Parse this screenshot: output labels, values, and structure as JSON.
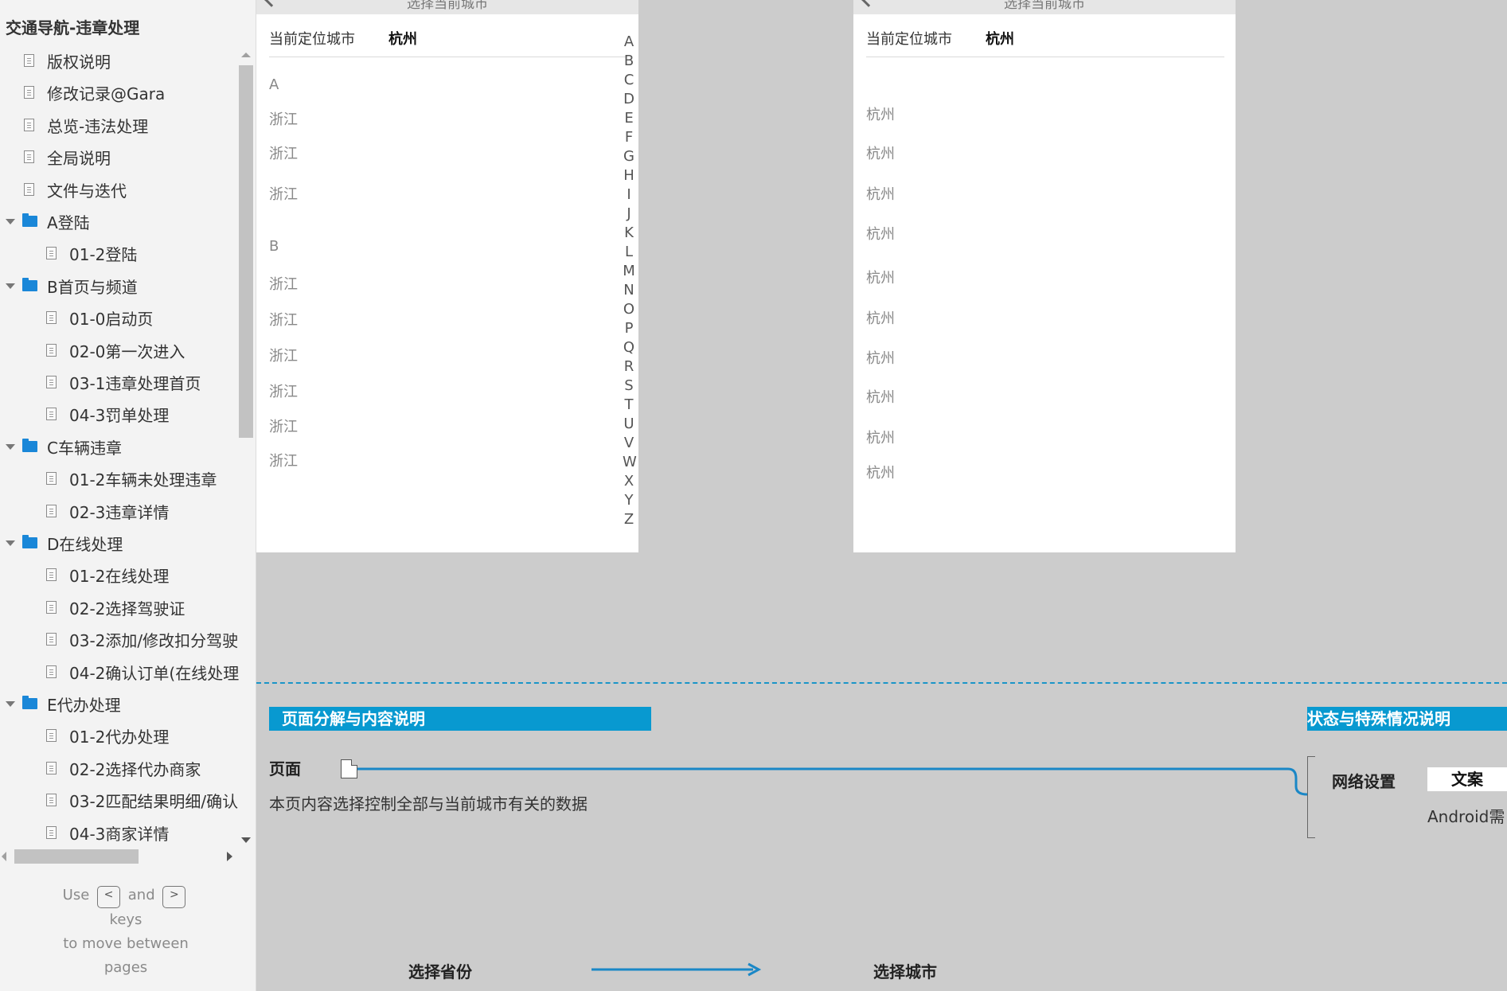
{
  "sidebar": {
    "title": "交通导航-违章处理",
    "items": [
      {
        "label": "版权说明",
        "type": "page",
        "level": 0
      },
      {
        "label": "修改记录@Gara",
        "type": "page",
        "level": 0
      },
      {
        "label": "总览-违法处理",
        "type": "page",
        "level": 0
      },
      {
        "label": "全局说明",
        "type": "page",
        "level": 0
      },
      {
        "label": "文件与迭代",
        "type": "page",
        "level": 0
      },
      {
        "label": "A登陆",
        "type": "folder",
        "level": 0
      },
      {
        "label": "01-2登陆",
        "type": "page",
        "level": 1
      },
      {
        "label": "B首页与频道",
        "type": "folder",
        "level": 0
      },
      {
        "label": "01-0启动页",
        "type": "page",
        "level": 1
      },
      {
        "label": "02-0第一次进入",
        "type": "page",
        "level": 1
      },
      {
        "label": "03-1违章处理首页",
        "type": "page",
        "level": 1
      },
      {
        "label": "04-3罚单处理",
        "type": "page",
        "level": 1
      },
      {
        "label": "C车辆违章",
        "type": "folder",
        "level": 0
      },
      {
        "label": "01-2车辆未处理违章",
        "type": "page",
        "level": 1
      },
      {
        "label": "02-3违章详情",
        "type": "page",
        "level": 1
      },
      {
        "label": "D在线处理",
        "type": "folder",
        "level": 0
      },
      {
        "label": "01-2在线处理",
        "type": "page",
        "level": 1
      },
      {
        "label": "02-2选择驾驶证",
        "type": "page",
        "level": 1
      },
      {
        "label": "03-2添加/修改扣分驾驶",
        "type": "page",
        "level": 1
      },
      {
        "label": "04-2确认订单(在线处理",
        "type": "page",
        "level": 1
      },
      {
        "label": "E代办处理",
        "type": "folder",
        "level": 0
      },
      {
        "label": "01-2代办处理",
        "type": "page",
        "level": 1
      },
      {
        "label": "02-2选择代办商家",
        "type": "page",
        "level": 1
      },
      {
        "label": "03-2匹配结果明细/确认",
        "type": "page",
        "level": 1
      },
      {
        "label": "04-3商家详情",
        "type": "page",
        "level": 1
      }
    ],
    "hint": {
      "use": "Use",
      "key_prev": "<",
      "and": "and",
      "key_next": ">",
      "keys": "keys",
      "line3": "to move between",
      "line4": "pages"
    }
  },
  "province_screen": {
    "header_title": "选择当前城市",
    "location_label": "当前定位城市",
    "location_value": "杭州",
    "sections": [
      {
        "letter": "A",
        "items": [
          "浙江",
          "浙江",
          "浙江"
        ]
      },
      {
        "letter": "B",
        "items": [
          "浙江",
          "浙江",
          "浙江",
          "浙江",
          "浙江",
          "浙江"
        ]
      }
    ],
    "index_letters": [
      "A",
      "B",
      "C",
      "D",
      "E",
      "F",
      "G",
      "H",
      "I",
      "J",
      "K",
      "L",
      "M",
      "N",
      "O",
      "P",
      "Q",
      "R",
      "S",
      "T",
      "U",
      "V",
      "W",
      "X",
      "Y",
      "Z"
    ]
  },
  "city_screen": {
    "header_title": "选择当前城市",
    "location_label": "当前定位城市",
    "location_value": "杭州",
    "items": [
      "杭州",
      "杭州",
      "杭州",
      "杭州",
      "杭州",
      "杭州",
      "杭州",
      "杭州",
      "杭州",
      "杭州"
    ]
  },
  "annotation": {
    "section_left": "页面分解与内容说明",
    "section_right": "状态与特殊情况说明",
    "page_label": "页面",
    "description": "本页内容选择控制全部与当前城市有关的数据",
    "network_label": "网络设置",
    "copy_label": "文案",
    "android_text": "Android需"
  },
  "flow": {
    "from": "选择省份",
    "to": "选择城市"
  },
  "colors": {
    "accent": "#0899d0",
    "folder": "#1a87d8",
    "canvas_bg": "#cccccc",
    "sidebar_bg": "#f3f3f3"
  }
}
